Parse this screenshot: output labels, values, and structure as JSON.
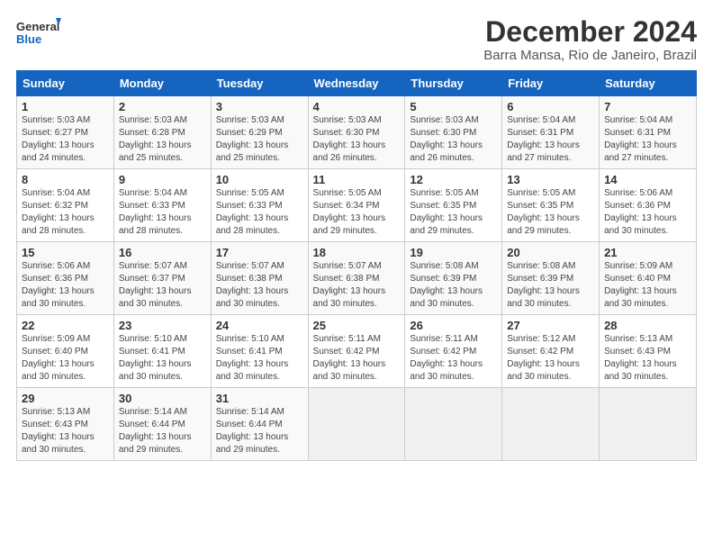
{
  "logo": {
    "line1": "General",
    "line2": "Blue"
  },
  "title": "December 2024",
  "subtitle": "Barra Mansa, Rio de Janeiro, Brazil",
  "days_header": [
    "Sunday",
    "Monday",
    "Tuesday",
    "Wednesday",
    "Thursday",
    "Friday",
    "Saturday"
  ],
  "weeks": [
    [
      {
        "day": "1",
        "sunrise": "Sunrise: 5:03 AM",
        "sunset": "Sunset: 6:27 PM",
        "daylight": "Daylight: 13 hours and 24 minutes."
      },
      {
        "day": "2",
        "sunrise": "Sunrise: 5:03 AM",
        "sunset": "Sunset: 6:28 PM",
        "daylight": "Daylight: 13 hours and 25 minutes."
      },
      {
        "day": "3",
        "sunrise": "Sunrise: 5:03 AM",
        "sunset": "Sunset: 6:29 PM",
        "daylight": "Daylight: 13 hours and 25 minutes."
      },
      {
        "day": "4",
        "sunrise": "Sunrise: 5:03 AM",
        "sunset": "Sunset: 6:30 PM",
        "daylight": "Daylight: 13 hours and 26 minutes."
      },
      {
        "day": "5",
        "sunrise": "Sunrise: 5:03 AM",
        "sunset": "Sunset: 6:30 PM",
        "daylight": "Daylight: 13 hours and 26 minutes."
      },
      {
        "day": "6",
        "sunrise": "Sunrise: 5:04 AM",
        "sunset": "Sunset: 6:31 PM",
        "daylight": "Daylight: 13 hours and 27 minutes."
      },
      {
        "day": "7",
        "sunrise": "Sunrise: 5:04 AM",
        "sunset": "Sunset: 6:31 PM",
        "daylight": "Daylight: 13 hours and 27 minutes."
      }
    ],
    [
      {
        "day": "8",
        "sunrise": "Sunrise: 5:04 AM",
        "sunset": "Sunset: 6:32 PM",
        "daylight": "Daylight: 13 hours and 28 minutes."
      },
      {
        "day": "9",
        "sunrise": "Sunrise: 5:04 AM",
        "sunset": "Sunset: 6:33 PM",
        "daylight": "Daylight: 13 hours and 28 minutes."
      },
      {
        "day": "10",
        "sunrise": "Sunrise: 5:05 AM",
        "sunset": "Sunset: 6:33 PM",
        "daylight": "Daylight: 13 hours and 28 minutes."
      },
      {
        "day": "11",
        "sunrise": "Sunrise: 5:05 AM",
        "sunset": "Sunset: 6:34 PM",
        "daylight": "Daylight: 13 hours and 29 minutes."
      },
      {
        "day": "12",
        "sunrise": "Sunrise: 5:05 AM",
        "sunset": "Sunset: 6:35 PM",
        "daylight": "Daylight: 13 hours and 29 minutes."
      },
      {
        "day": "13",
        "sunrise": "Sunrise: 5:05 AM",
        "sunset": "Sunset: 6:35 PM",
        "daylight": "Daylight: 13 hours and 29 minutes."
      },
      {
        "day": "14",
        "sunrise": "Sunrise: 5:06 AM",
        "sunset": "Sunset: 6:36 PM",
        "daylight": "Daylight: 13 hours and 30 minutes."
      }
    ],
    [
      {
        "day": "15",
        "sunrise": "Sunrise: 5:06 AM",
        "sunset": "Sunset: 6:36 PM",
        "daylight": "Daylight: 13 hours and 30 minutes."
      },
      {
        "day": "16",
        "sunrise": "Sunrise: 5:07 AM",
        "sunset": "Sunset: 6:37 PM",
        "daylight": "Daylight: 13 hours and 30 minutes."
      },
      {
        "day": "17",
        "sunrise": "Sunrise: 5:07 AM",
        "sunset": "Sunset: 6:38 PM",
        "daylight": "Daylight: 13 hours and 30 minutes."
      },
      {
        "day": "18",
        "sunrise": "Sunrise: 5:07 AM",
        "sunset": "Sunset: 6:38 PM",
        "daylight": "Daylight: 13 hours and 30 minutes."
      },
      {
        "day": "19",
        "sunrise": "Sunrise: 5:08 AM",
        "sunset": "Sunset: 6:39 PM",
        "daylight": "Daylight: 13 hours and 30 minutes."
      },
      {
        "day": "20",
        "sunrise": "Sunrise: 5:08 AM",
        "sunset": "Sunset: 6:39 PM",
        "daylight": "Daylight: 13 hours and 30 minutes."
      },
      {
        "day": "21",
        "sunrise": "Sunrise: 5:09 AM",
        "sunset": "Sunset: 6:40 PM",
        "daylight": "Daylight: 13 hours and 30 minutes."
      }
    ],
    [
      {
        "day": "22",
        "sunrise": "Sunrise: 5:09 AM",
        "sunset": "Sunset: 6:40 PM",
        "daylight": "Daylight: 13 hours and 30 minutes."
      },
      {
        "day": "23",
        "sunrise": "Sunrise: 5:10 AM",
        "sunset": "Sunset: 6:41 PM",
        "daylight": "Daylight: 13 hours and 30 minutes."
      },
      {
        "day": "24",
        "sunrise": "Sunrise: 5:10 AM",
        "sunset": "Sunset: 6:41 PM",
        "daylight": "Daylight: 13 hours and 30 minutes."
      },
      {
        "day": "25",
        "sunrise": "Sunrise: 5:11 AM",
        "sunset": "Sunset: 6:42 PM",
        "daylight": "Daylight: 13 hours and 30 minutes."
      },
      {
        "day": "26",
        "sunrise": "Sunrise: 5:11 AM",
        "sunset": "Sunset: 6:42 PM",
        "daylight": "Daylight: 13 hours and 30 minutes."
      },
      {
        "day": "27",
        "sunrise": "Sunrise: 5:12 AM",
        "sunset": "Sunset: 6:42 PM",
        "daylight": "Daylight: 13 hours and 30 minutes."
      },
      {
        "day": "28",
        "sunrise": "Sunrise: 5:13 AM",
        "sunset": "Sunset: 6:43 PM",
        "daylight": "Daylight: 13 hours and 30 minutes."
      }
    ],
    [
      {
        "day": "29",
        "sunrise": "Sunrise: 5:13 AM",
        "sunset": "Sunset: 6:43 PM",
        "daylight": "Daylight: 13 hours and 30 minutes."
      },
      {
        "day": "30",
        "sunrise": "Sunrise: 5:14 AM",
        "sunset": "Sunset: 6:44 PM",
        "daylight": "Daylight: 13 hours and 29 minutes."
      },
      {
        "day": "31",
        "sunrise": "Sunrise: 5:14 AM",
        "sunset": "Sunset: 6:44 PM",
        "daylight": "Daylight: 13 hours and 29 minutes."
      },
      null,
      null,
      null,
      null
    ]
  ]
}
